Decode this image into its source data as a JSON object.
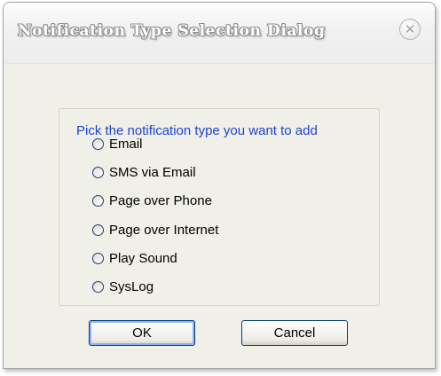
{
  "dialog": {
    "title": "Notification Type Selection Dialog",
    "close_symbol": "✕",
    "prompt": "Pick the notification type you want to add",
    "options": [
      {
        "label": "Email",
        "selected": false
      },
      {
        "label": "SMS via Email",
        "selected": false
      },
      {
        "label": "Page over Phone",
        "selected": false
      },
      {
        "label": "Page over Internet",
        "selected": false
      },
      {
        "label": "Play Sound",
        "selected": false
      },
      {
        "label": "SysLog",
        "selected": false
      }
    ],
    "ok_label": "OK",
    "cancel_label": "Cancel"
  },
  "colors": {
    "prompt_text": "#1d44d4",
    "dialog_background": "#f0efe8",
    "button_border": "#003c74"
  },
  "icons": {
    "close": "close-icon",
    "radio": "radio-button-icon"
  }
}
